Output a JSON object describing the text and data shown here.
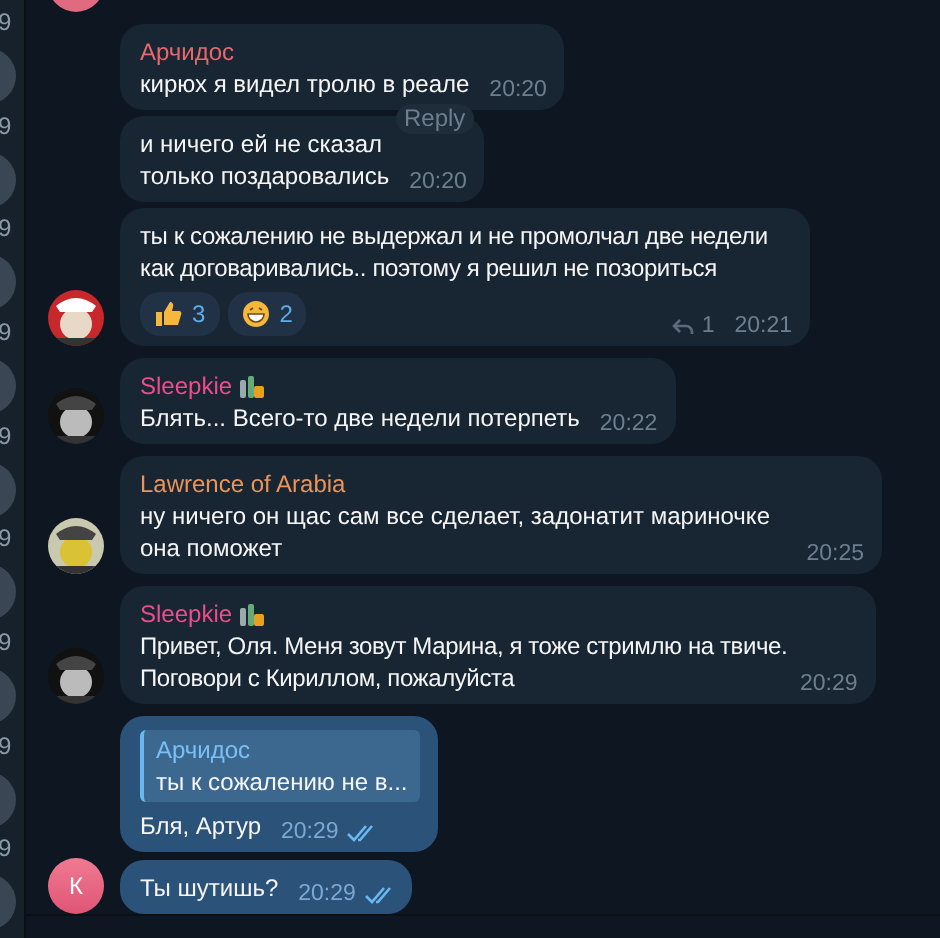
{
  "side_strip": {
    "items": [
      {
        "text": "9"
      },
      {
        "text": "9"
      },
      {
        "text": "9"
      },
      {
        "text": "9"
      },
      {
        "text": "9"
      },
      {
        "text": "9"
      },
      {
        "text": "9"
      },
      {
        "text": "9"
      },
      {
        "text": "9"
      }
    ]
  },
  "messages": [
    {
      "kind": "incoming",
      "first": true,
      "sender": "Арчидос",
      "color": "#e8676b",
      "name_badge": false,
      "text": "кирюх я видел тролю в реале",
      "time": "20:20",
      "hover_action": "Reply"
    },
    {
      "kind": "incoming",
      "first": false,
      "text": "и ничего ей не сказал\nтолько поздаровались",
      "time": "20:20"
    },
    {
      "kind": "incoming",
      "first": false,
      "text": "ты к сожалению не выдержал и не промолчал две недели как договаривались.. поэтому я решил не позориться",
      "time": "20:21",
      "reactions": [
        {
          "kind": "thumbs_up",
          "count": "3"
        },
        {
          "kind": "grin",
          "count": "2"
        }
      ],
      "reply_count": "1"
    },
    {
      "kind": "incoming",
      "first": true,
      "sender": "Sleepkie",
      "color": "#ee4c8a",
      "name_badge": true,
      "text": "Блять... Всего-то две недели потерпеть",
      "time": "20:22"
    },
    {
      "kind": "incoming",
      "first": true,
      "sender": "Lawrence of Arabia",
      "color": "#e8945a",
      "name_badge": false,
      "text": "ну ничего он щас сам все сделает, задонатит мариночке она поможет",
      "time": "20:25"
    },
    {
      "kind": "incoming",
      "first": true,
      "sender": "Sleepkie",
      "color": "#ee4c8a",
      "name_badge": true,
      "text": "Привет, Оля. Меня зовут Марина, я тоже стримлю на твиче. Поговори с Кириллом, пожалуйста",
      "time": "20:29"
    },
    {
      "kind": "outgoing",
      "first": true,
      "quote": {
        "sender": "Арчидос",
        "text": "ты к сожалению не в..."
      },
      "text": "Бля, Артур",
      "time": "20:29",
      "read": true
    },
    {
      "kind": "outgoing",
      "avatar": {
        "kind": "letter",
        "letter": "К"
      },
      "first": false,
      "text": "Ты шутишь?",
      "time": "20:29",
      "read": true
    }
  ]
}
